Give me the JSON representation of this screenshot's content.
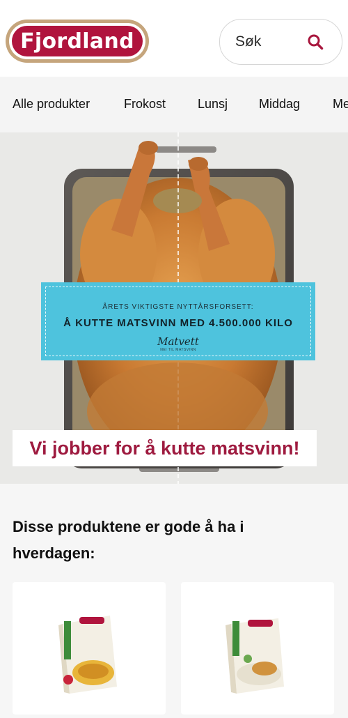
{
  "header": {
    "logo_text": "Fjordland",
    "search_label": "Søk",
    "brand_color": "#b0143d"
  },
  "nav": {
    "items": [
      {
        "label": "Alle produkter"
      },
      {
        "label": "Frokost"
      },
      {
        "label": "Lunsj"
      },
      {
        "label": "Middag"
      },
      {
        "label": "Me"
      }
    ]
  },
  "hero": {
    "promo_small": "ÅRETS VIKTIGSTE NYTTÅRSFORSETT:",
    "promo_big": "Å KUTTE MATSVINN MED 4.500.000 KILO",
    "promo_brand": "Matvett",
    "promo_brand_sub": "NEI TIL MATSVINN",
    "banner_text": "Vi jobber for å kutte matsvinn!",
    "promo_color": "#4ec3dd"
  },
  "section": {
    "title": "Disse produktene er gode å ha i hverdagen:"
  },
  "products": [
    {
      "name": "soup-product",
      "icon": "package-image-soup"
    },
    {
      "name": "chicken-product",
      "icon": "package-image-chicken"
    }
  ]
}
